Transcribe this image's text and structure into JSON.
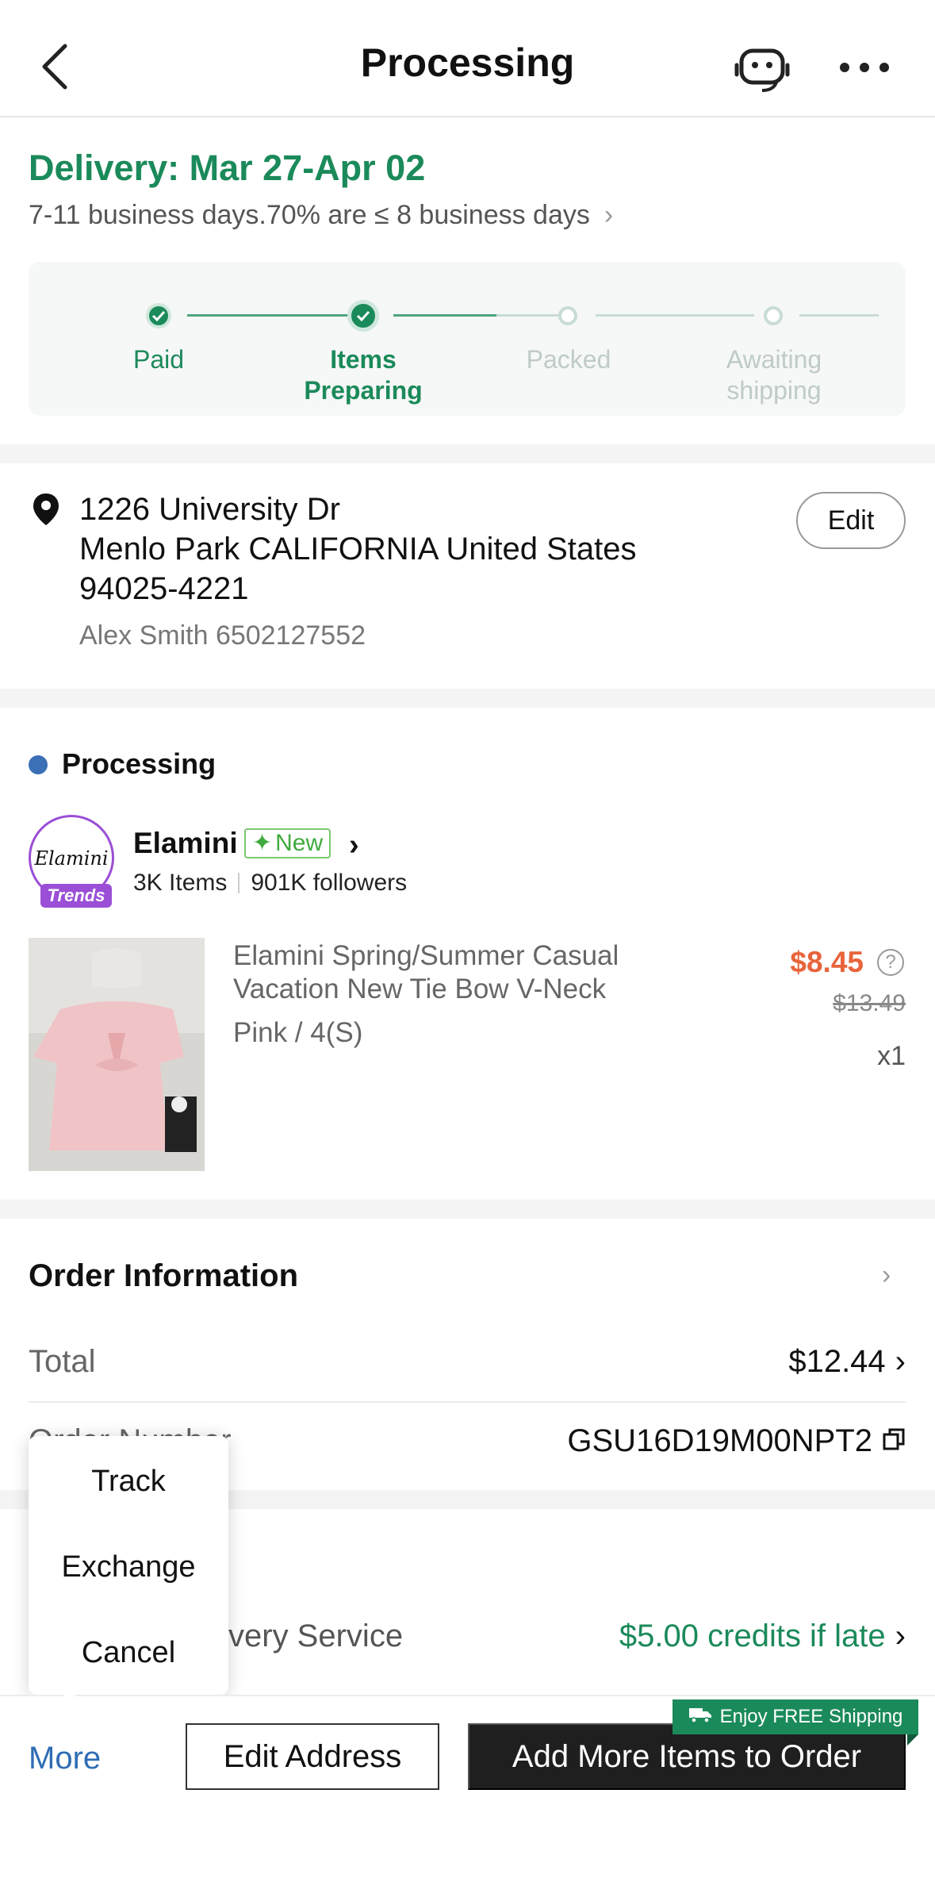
{
  "header": {
    "title": "Processing"
  },
  "delivery": {
    "title": "Delivery: Mar 27-Apr 02",
    "subtitle": "7-11 business days.70% are ≤ 8 business days"
  },
  "progress": {
    "steps": [
      {
        "label": "Paid",
        "state": "done"
      },
      {
        "label": "Items Preparing",
        "state": "current"
      },
      {
        "label": "Packed",
        "state": "todo"
      },
      {
        "label": "Awaiting shipping",
        "state": "todo"
      }
    ]
  },
  "address": {
    "line1": "1226 University Dr",
    "line2": "Menlo Park CALIFORNIA United States",
    "line3": "94025-4221",
    "recipient": "Alex Smith 6502127552",
    "edit_label": "Edit"
  },
  "order": {
    "status": "Processing",
    "store": {
      "name": "Elamini",
      "badge": "New",
      "items": "3K Items",
      "followers": "901K followers",
      "logo_text": "Elamini",
      "logo_tag": "Trends"
    },
    "product": {
      "title": "Elamini Spring/Summer Casual Vacation New Tie Bow V-Neck",
      "variant": "Pink / 4(S)",
      "price": "$8.45",
      "original_price": "$13.49",
      "quantity": "x1"
    }
  },
  "order_info": {
    "title": "Order Information",
    "total_label": "Total",
    "total_value": "$12.44",
    "number_label": "Order Number",
    "number_value": "GSU16D19M00NPT2",
    "delivery_service_label": "very Service",
    "delivery_service_value": "$5.00 credits if late"
  },
  "popup_menu": {
    "items": [
      "Track",
      "Exchange",
      "Cancel"
    ]
  },
  "bottom_bar": {
    "more_label": "More",
    "edit_address_label": "Edit Address",
    "add_items_label": "Add More Items to Order",
    "free_shipping_tag": "Enjoy FREE Shipping"
  },
  "colors": {
    "accent_green": "#1b8a5a",
    "price_orange": "#e8643b",
    "link_blue": "#2f6db4"
  }
}
